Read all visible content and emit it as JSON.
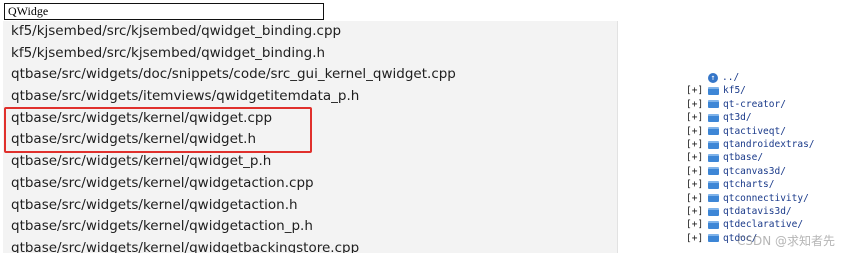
{
  "search": {
    "value": "QWidge"
  },
  "results": [
    "kf5/kjsembed/src/kjsembed/qwidget_binding.cpp",
    "kf5/kjsembed/src/kjsembed/qwidget_binding.h",
    "qtbase/src/widgets/doc/snippets/code/src_gui_kernel_qwidget.cpp",
    "qtbase/src/widgets/itemviews/qwidgetitemdata_p.h",
    "qtbase/src/widgets/kernel/qwidget.cpp",
    "qtbase/src/widgets/kernel/qwidget.h",
    "qtbase/src/widgets/kernel/qwidget_p.h",
    "qtbase/src/widgets/kernel/qwidgetaction.cpp",
    "qtbase/src/widgets/kernel/qwidgetaction.h",
    "qtbase/src/widgets/kernel/qwidgetaction_p.h",
    "qtbase/src/widgets/kernel/qwidgetbackingstore.cpp"
  ],
  "highlight_color": "#e0302c",
  "directory": {
    "up": "../",
    "expand_marker": "[+]",
    "folders": [
      "kf5/",
      "qt-creator/",
      "qt3d/",
      "qtactiveqt/",
      "qtandroidextras/",
      "qtbase/",
      "qtcanvas3d/",
      "qtcharts/",
      "qtconnectivity/",
      "qtdatavis3d/",
      "qtdeclarative/",
      "qtdoc/"
    ]
  },
  "watermark": "CSDN @求知者先"
}
